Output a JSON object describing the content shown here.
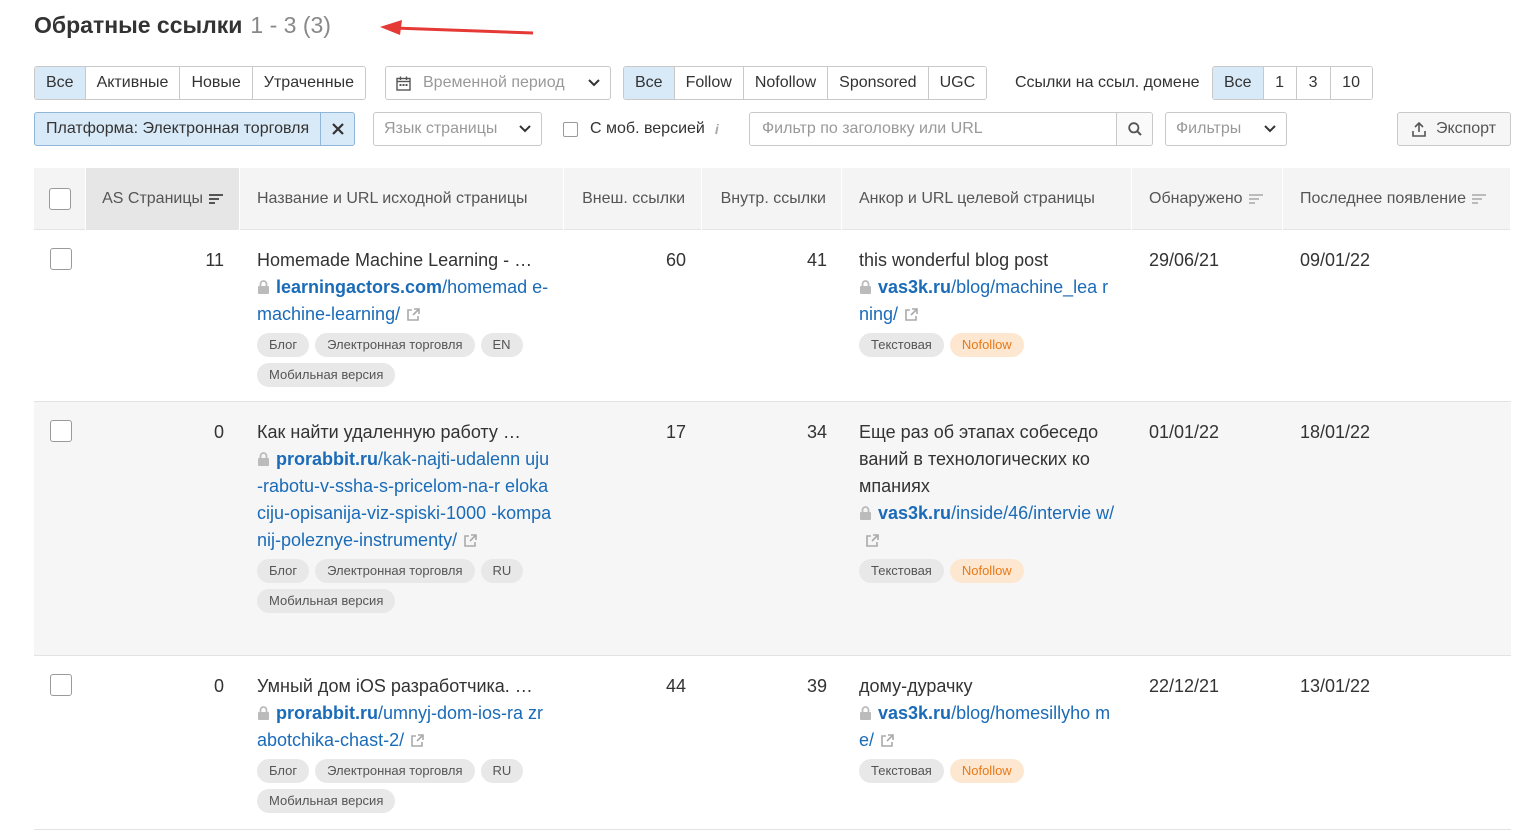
{
  "header": {
    "title": "Обратные ссылки",
    "count": "1 - 3 (3)"
  },
  "status_filter": {
    "items": [
      "Все",
      "Активные",
      "Новые",
      "Утраченные"
    ],
    "active": 0
  },
  "period_dropdown": {
    "placeholder": "Временной период"
  },
  "type_filter": {
    "items": [
      "Все",
      "Follow",
      "Nofollow",
      "Sponsored",
      "UGC"
    ],
    "active": 0
  },
  "per_domain": {
    "label": "Ссылки на ссыл. домене",
    "items": [
      "Все",
      "1",
      "3",
      "10"
    ],
    "active": 0
  },
  "platform_chip": {
    "label": "Платформа: Электронная торговля"
  },
  "language_dropdown": {
    "placeholder": "Язык страницы"
  },
  "mobile_checkbox": {
    "label": "С моб. версией"
  },
  "search": {
    "placeholder": "Фильтр по заголовку или URL"
  },
  "filters_dropdown": {
    "placeholder": "Фильтры"
  },
  "export_button": {
    "label": "Экспорт"
  },
  "table": {
    "columns": [
      "AS Страницы",
      "Название и URL исходной страницы",
      "Внеш. ссылки",
      "Внутр. ссылки",
      "Анкор и URL целевой страницы",
      "Обнаружено",
      "Последнее появление"
    ],
    "rows": [
      {
        "as": "11",
        "title": "Homemade Machine Learning - …",
        "src_domain": "learningactors.com",
        "src_path": "/homemad e-machine-learning/",
        "src_tags": [
          "Блог",
          "Электронная торговля",
          "EN",
          "Мобильная версия"
        ],
        "ext_links": "60",
        "int_links": "41",
        "anchor": "this wonderful blog post",
        "target_domain": "vas3k.ru",
        "target_path": "/blog/machine_lea rning/",
        "target_tags": [
          "Текстовая",
          "Nofollow"
        ],
        "found": "29/06/21",
        "last_seen": "09/01/22"
      },
      {
        "as": "0",
        "title": "Как найти удаленную работу …",
        "src_domain": "prorabbit.ru",
        "src_path": "/kak-najti-udalenn uju-rabotu-v-ssha-s-pricelom-na-r elokaciju-opisanija-viz-spiski-1000 -kompanij-poleznye-instrumenty/",
        "src_tags": [
          "Блог",
          "Электронная торговля",
          "RU",
          "Мобильная версия"
        ],
        "ext_links": "17",
        "int_links": "34",
        "anchor": "Еще раз об этапах собеседо ваний в технологических ко мпаниях",
        "target_domain": "vas3k.ru",
        "target_path": "/inside/46/intervie w/",
        "target_tags": [
          "Текстовая",
          "Nofollow"
        ],
        "found": "01/01/22",
        "last_seen": "18/01/22"
      },
      {
        "as": "0",
        "title": "Умный дом iOS разработчика. …",
        "src_domain": "prorabbit.ru",
        "src_path": "/umnyj-dom-ios-ra zrabotchika-chast-2/",
        "src_tags": [
          "Блог",
          "Электронная торговля",
          "RU",
          "Мобильная версия"
        ],
        "ext_links": "44",
        "int_links": "39",
        "anchor": "дому-дурачку",
        "target_domain": "vas3k.ru",
        "target_path": "/blog/homesillyho me/",
        "target_tags": [
          "Текстовая",
          "Nofollow"
        ],
        "found": "22/12/21",
        "last_seen": "13/01/22"
      }
    ]
  },
  "colors": {
    "accent_bg": "#d8e9f7",
    "link": "#1a6bb8",
    "nofollow": "#e87a17",
    "arrow": "#e53935"
  }
}
